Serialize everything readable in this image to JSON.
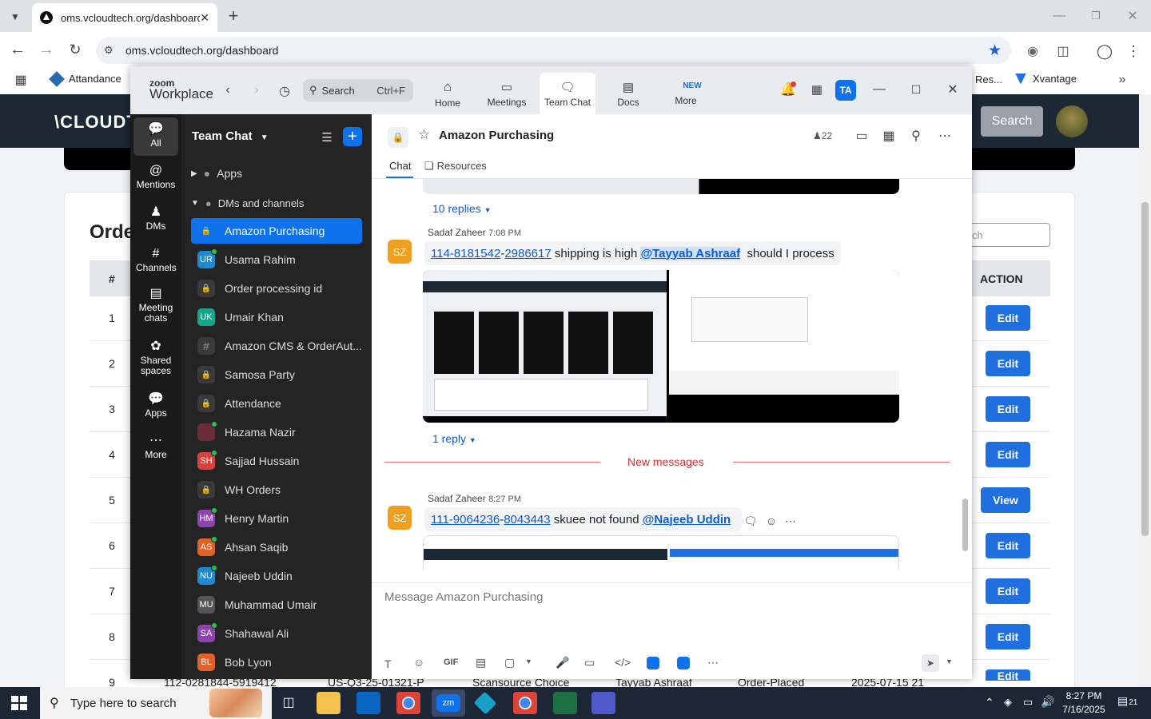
{
  "browser": {
    "tab_title": "oms.vcloudtech.org/dashboard",
    "url": "oms.vcloudtech.org/dashboard",
    "bookmarks": [
      "Attandance",
      "Res...",
      "Xvantage"
    ]
  },
  "site": {
    "logo": "\\CLOUDT",
    "search_button": "Search",
    "search_placeholder": "ch",
    "heading": "Orde",
    "table": {
      "col_number": "#",
      "col_action": "ACTION",
      "row_numbers": [
        "1",
        "2",
        "3",
        "4",
        "5",
        "6",
        "7",
        "8",
        "9"
      ],
      "actions": [
        "Edit",
        "Edit",
        "Edit",
        "Edit",
        "View",
        "Edit",
        "Edit",
        "Edit",
        "Edit"
      ],
      "row9_cells": [
        "112-0281844-5919412",
        "US-Q3-25-01321-P",
        "Scansource Choice",
        "Tayyab Ashraaf",
        "Order-Placed",
        "2025-07-15 21"
      ]
    }
  },
  "zoom": {
    "brand_top": "zoom",
    "brand_bottom": "Workplace",
    "search_label": "Search",
    "search_shortcut": "Ctrl+F",
    "tabs": [
      "Home",
      "Meetings",
      "Team Chat",
      "Docs",
      "More"
    ],
    "more_badge": "NEW",
    "avatar_initials": "TA",
    "rail": [
      "All",
      "Mentions",
      "DMs",
      "Channels",
      "Meeting chats",
      "Shared spaces",
      "Apps",
      "More"
    ],
    "sidebar": {
      "title": "Team Chat",
      "apps": "Apps",
      "dms_channels": "DMs and channels",
      "items": [
        {
          "name": "Amazon Purchasing",
          "type": "lock",
          "color": "#0e72ed"
        },
        {
          "name": "Usama Rahim",
          "type": "person",
          "initials": "UR",
          "color": "#1f8ad1",
          "online": true
        },
        {
          "name": "Order processing id",
          "type": "lock"
        },
        {
          "name": "Umair Khan",
          "type": "person",
          "initials": "UK",
          "color": "#17a589",
          "online": false
        },
        {
          "name": "Amazon CMS & OrderAut...",
          "type": "hash"
        },
        {
          "name": "Samosa Party",
          "type": "lock"
        },
        {
          "name": "Attendance",
          "type": "lock"
        },
        {
          "name": "Hazama Nazir",
          "type": "person",
          "initials": "",
          "color": "#6b2d3a",
          "online": true
        },
        {
          "name": "Sajjad Hussain",
          "type": "person",
          "initials": "SH",
          "color": "#d9413a",
          "online": true
        },
        {
          "name": "WH Orders",
          "type": "lock"
        },
        {
          "name": "Henry Martin",
          "type": "person",
          "initials": "HM",
          "color": "#8e44ad",
          "online": true
        },
        {
          "name": "Ahsan Saqib",
          "type": "person",
          "initials": "AS",
          "color": "#e0622a",
          "online": true
        },
        {
          "name": "Najeeb Uddin",
          "type": "person",
          "initials": "NU",
          "color": "#1f8ad1",
          "online": true
        },
        {
          "name": "Muhammad Umair",
          "type": "person",
          "initials": "MU",
          "color": "#555",
          "online": false
        },
        {
          "name": "Shahawal Ali",
          "type": "person",
          "initials": "SA",
          "color": "#8e44ad",
          "online": true
        },
        {
          "name": "Bob Lyon",
          "type": "person",
          "initials": "BL",
          "color": "#e0622a",
          "online": false
        }
      ]
    },
    "channel": {
      "name": "Amazon Purchasing",
      "members": "22",
      "tab_chat": "Chat",
      "tab_resources": "Resources",
      "replies_1": "10 replies",
      "msg1": {
        "author": "Sadaf Zaheer",
        "time": "7:08 PM",
        "initials": "SZ",
        "link_a": "114-8181542",
        "link_b": "2986617",
        "text": "shipping is high",
        "mention": "@Tayyab Ashraaf",
        "text2": "should I process"
      },
      "replies_2": "1 reply",
      "new_messages": "New messages",
      "msg2": {
        "author": "Sadaf Zaheer",
        "time": "8:27 PM",
        "initials": "SZ",
        "link_a": "111-9064236",
        "link_b": "8043443",
        "text": "skuee not found",
        "mention": "@Najeeb Uddin"
      },
      "composer_placeholder": "Message Amazon Purchasing",
      "gif": "GIF"
    }
  },
  "taskbar": {
    "search_placeholder": "Type here to search",
    "time": "8:27 PM",
    "date": "7/16/2025",
    "notifications": "21"
  }
}
